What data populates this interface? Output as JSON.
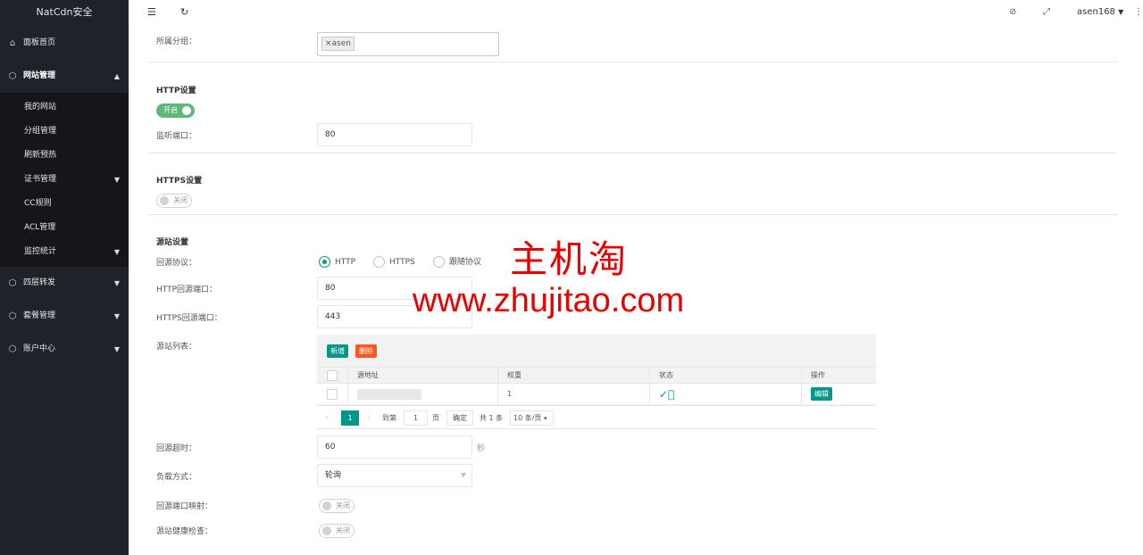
{
  "app": {
    "title": "NatCdn安全"
  },
  "sidebar": {
    "items": [
      {
        "label": "面板首页",
        "icon": "home-icon"
      },
      {
        "label": "网站管理",
        "icon": "cube-icon",
        "expanded": true
      },
      {
        "label": "四层转发",
        "icon": "cube-icon"
      },
      {
        "label": "套餐管理",
        "icon": "cube-icon"
      },
      {
        "label": "账户中心",
        "icon": "cube-icon"
      }
    ],
    "sub_items": [
      {
        "label": "我的网站"
      },
      {
        "label": "分组管理"
      },
      {
        "label": "刷新预热"
      },
      {
        "label": "证书管理"
      },
      {
        "label": "CC规则"
      },
      {
        "label": "ACL管理"
      },
      {
        "label": "监控统计"
      }
    ]
  },
  "header": {
    "username": "asen168",
    "icons": [
      "menu-fold-icon",
      "refresh-icon",
      "tag-icon",
      "fullscreen-icon",
      "more-icon"
    ]
  },
  "form": {
    "group_label": "所属分组：",
    "group_tag": "×asen",
    "http_section": "HTTP设置",
    "http_switch": "开启",
    "listen_port_label": "监听端口：",
    "listen_port": "80",
    "https_section": "HTTPS设置",
    "https_switch": "关闭",
    "origin_section": "源站设置",
    "origin_protocol_label": "回源协议：",
    "protocols": [
      "HTTP",
      "HTTPS",
      "跟随协议"
    ],
    "protocol_selected": "HTTP",
    "http_origin_port_label": "HTTP回源端口：",
    "http_origin_port": "80",
    "https_origin_port_label": "HTTPS回源端口：",
    "https_origin_port": "443",
    "origin_list_label": "源站列表：",
    "timeout_label": "回源超时：",
    "timeout": "60",
    "timeout_unit": "秒",
    "balance_label": "负载方式：",
    "balance": "轮询",
    "port_map_label": "回源端口映射：",
    "port_map_switch": "关闭",
    "health_label": "源站健康检查：",
    "health_switch": "关闭"
  },
  "table": {
    "add_label": "新增",
    "delete_label": "删除",
    "columns": [
      "源地址",
      "权重",
      "状态",
      "操作"
    ],
    "rows": [
      {
        "weight": "1",
        "edit_label": "编辑"
      }
    ],
    "pager": {
      "current": "1",
      "goto_label": "到第",
      "goto_value": "1",
      "page_label": "页",
      "confirm_label": "确定",
      "total_label": "共 1 条",
      "per_page": "10 条/页"
    }
  },
  "watermark": {
    "cn": "主机淘",
    "url": "www.zhujitao.com"
  },
  "colors": {
    "sidebar": "#20222a",
    "accent": "#009688",
    "success": "#5fb878",
    "danger": "#ff5722",
    "watermark": "#e60000"
  }
}
